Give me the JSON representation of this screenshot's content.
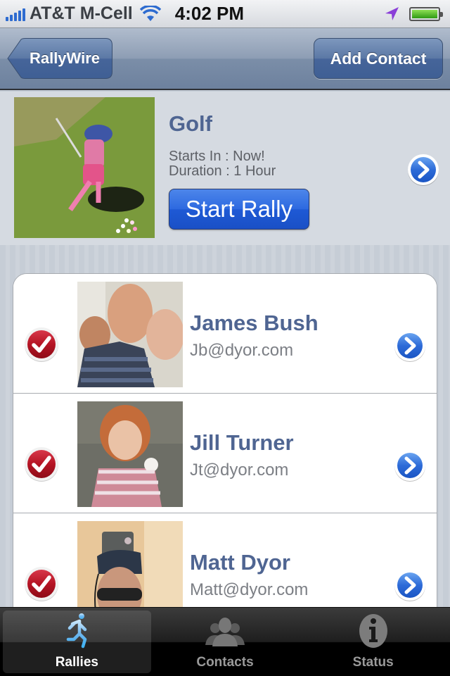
{
  "status_bar": {
    "carrier": "AT&T M-Cell",
    "time": "4:02 PM",
    "signal_bars": 5,
    "battery_level": 1.0
  },
  "nav_bar": {
    "back_label": "RallyWire",
    "add_label": "Add Contact"
  },
  "rally": {
    "title": "Golf",
    "starts_in": "Starts In : Now!",
    "duration": "Duration : 1 Hour",
    "start_label": "Start Rally",
    "photo": "golf-swing-photo"
  },
  "contacts": [
    {
      "name": "James Bush",
      "email": "Jb@dyor.com",
      "checked": true,
      "photo": "james-bush-photo"
    },
    {
      "name": "Jill Turner",
      "email": "Jt@dyor.com",
      "checked": true,
      "photo": "jill-turner-photo"
    },
    {
      "name": "Matt Dyor",
      "email": "Matt@dyor.com",
      "checked": true,
      "photo": "matt-dyor-photo"
    }
  ],
  "tab_bar": {
    "tabs": [
      {
        "label": "Rallies",
        "icon": "runner-icon",
        "active": true
      },
      {
        "label": "Contacts",
        "icon": "people-icon",
        "active": false
      },
      {
        "label": "Status",
        "icon": "info-icon",
        "active": false
      }
    ]
  },
  "colors": {
    "accent_blue": "#2d69e0",
    "title_blue": "#4f6592",
    "check_red": "#b51424",
    "active_tab_icon": "#5ec4f5"
  }
}
